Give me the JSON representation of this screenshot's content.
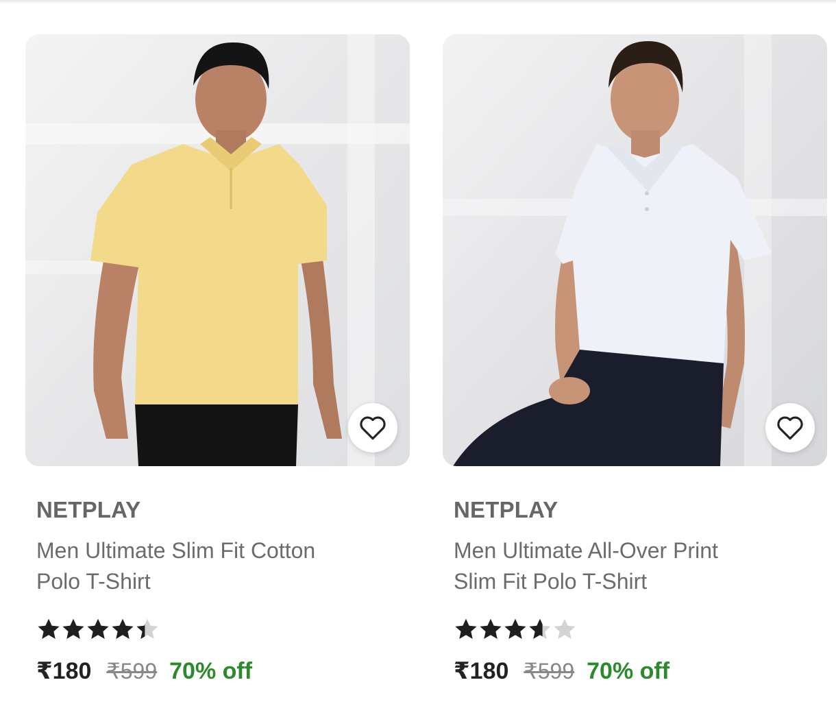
{
  "products": [
    {
      "brand": "NETPLAY",
      "title_line1": "Men Ultimate Slim Fit Cotton",
      "title_line2": "Polo T-Shirt",
      "rating": 4.4,
      "price": "₹180",
      "mrp": "₹599",
      "discount": "70% off",
      "shirt_color": "#f3d98a",
      "pants_color": "#141414",
      "wishlist_icon": "heart-outline-icon"
    },
    {
      "brand": "NETPLAY",
      "title_line1": "Men Ultimate All-Over Print",
      "title_line2": "Slim Fit Polo T-Shirt",
      "rating": 3.6,
      "price": "₹180",
      "mrp": "₹599",
      "discount": "70% off",
      "shirt_color": "#eef1f7",
      "pants_color": "#1a1d2b",
      "wishlist_icon": "heart-outline-icon"
    }
  ],
  "colors": {
    "discount": "#2b8a2b",
    "star_filled": "#1f1f1f",
    "star_empty": "#d3d3d3"
  }
}
